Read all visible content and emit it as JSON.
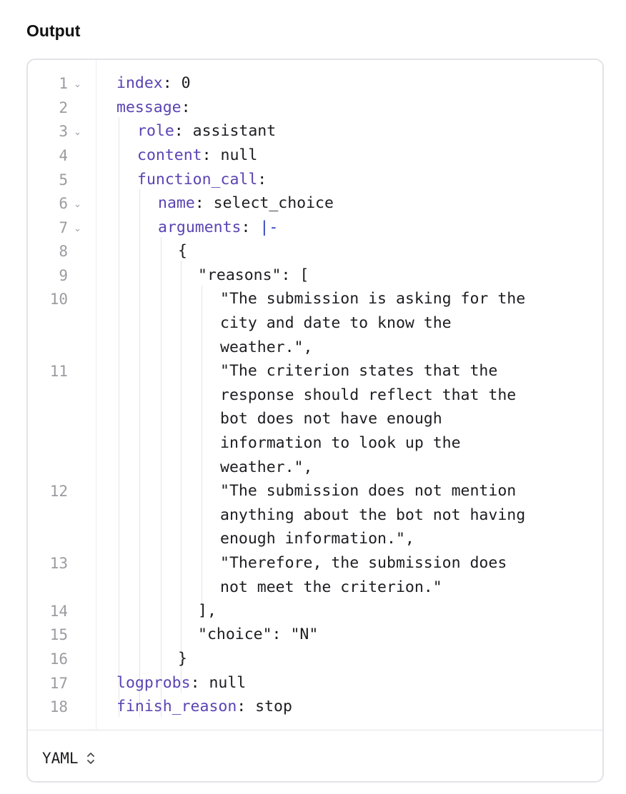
{
  "section": {
    "title": "Output"
  },
  "code": {
    "language_selector": {
      "value": "YAML",
      "icon": "chevrons-up-down-icon"
    },
    "colors": {
      "key": "#5b43b3",
      "block_indicator": "#2b3ec0",
      "text": "#1d1d21",
      "line_number": "#9b9ba1"
    },
    "line_numbers": [
      "1",
      "2",
      "3",
      "4",
      "5",
      "6",
      "7",
      "8",
      "9",
      "10",
      "11",
      "12",
      "13",
      "14",
      "15",
      "16",
      "17",
      "18"
    ],
    "rows": {
      "r1": {
        "key": "index",
        "sep": ": ",
        "val": "0"
      },
      "r2": {
        "key": "message",
        "sep": ":"
      },
      "r3": {
        "key": "role",
        "sep": ": ",
        "val": "assistant"
      },
      "r4": {
        "key": "content",
        "sep": ": ",
        "val": "null"
      },
      "r5": {
        "key": "function_call",
        "sep": ":"
      },
      "r6": {
        "key": "name",
        "sep": ": ",
        "val": "select_choice"
      },
      "r7": {
        "key": "arguments",
        "sep": ": ",
        "val": "|-"
      },
      "r8": {
        "text": "{"
      },
      "r9": {
        "text": "\"reasons\": ["
      },
      "r10": {
        "lines": [
          "\"The submission is asking for the",
          "city and date to know the",
          "weather.\","
        ]
      },
      "r11": {
        "lines": [
          "\"The criterion states that the",
          "response should reflect that the",
          "bot does not have enough",
          "information to look up the",
          "weather.\","
        ]
      },
      "r12": {
        "lines": [
          "\"The submission does not mention",
          "anything about the bot not having",
          "enough information.\","
        ]
      },
      "r13": {
        "lines": [
          "\"Therefore, the submission does",
          "not meet the criterion.\""
        ]
      },
      "r14": {
        "text": "],"
      },
      "r15": {
        "text": "\"choice\": \"N\""
      },
      "r16": {
        "text": "}"
      },
      "r17": {
        "key": "logprobs",
        "sep": ": ",
        "val": "null"
      },
      "r18": {
        "key": "finish_reason",
        "sep": ": ",
        "val": "stop"
      }
    }
  }
}
